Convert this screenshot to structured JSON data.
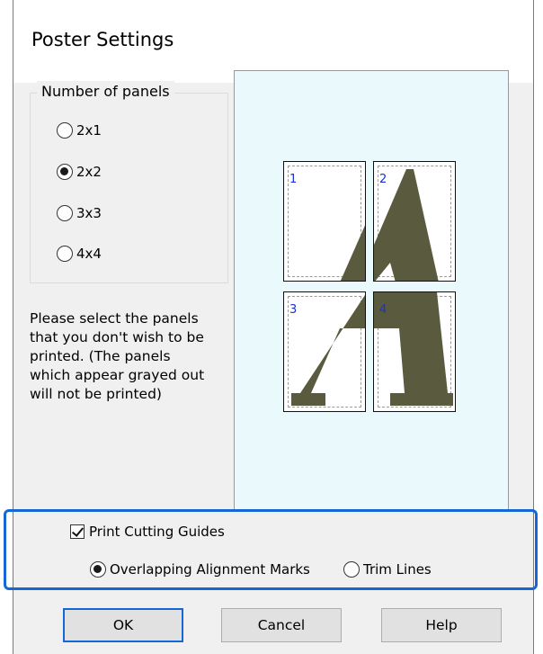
{
  "dialog": {
    "title": "Poster Settings"
  },
  "panels_group": {
    "legend": "Number of panels",
    "options": [
      {
        "label": "2x1",
        "selected": false
      },
      {
        "label": "2x2",
        "selected": true
      },
      {
        "label": "3x3",
        "selected": false
      },
      {
        "label": "4x4",
        "selected": false
      }
    ]
  },
  "instructions": "Please select the panels\nthat you don't wish to be\nprinted. (The panels\nwhich appear grayed out\nwill not be printed)",
  "preview": {
    "panels": [
      "1",
      "2",
      "3",
      "4"
    ],
    "glyph_color": "#5a5a3e",
    "number_color": "#1c2fd1"
  },
  "cutting_guides": {
    "checkbox_label": "Print Cutting Guides",
    "checked": true,
    "options": [
      {
        "label": "Overlapping Alignment Marks",
        "selected": true
      },
      {
        "label": "Trim Lines",
        "selected": false
      }
    ]
  },
  "buttons": {
    "ok": "OK",
    "cancel": "Cancel",
    "help": "Help"
  },
  "colors": {
    "highlight": "#1667d6",
    "preview_background": "#eafafc",
    "dialog_background": "#f0f0f0"
  }
}
